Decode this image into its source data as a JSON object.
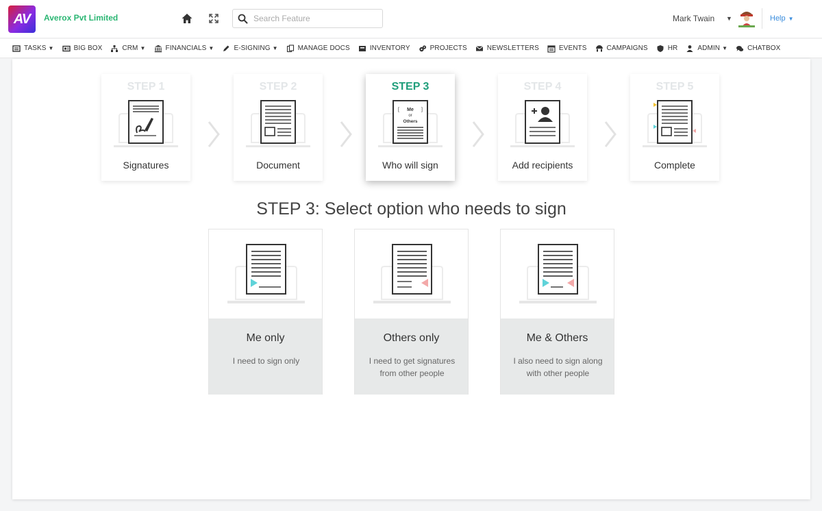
{
  "header": {
    "logo_text": "AV",
    "company": "Averox Pvt Limited",
    "search": {
      "placeholder": "Search Feature",
      "value": ""
    },
    "user_name": "Mark Twain",
    "help_label": "Help"
  },
  "menu": [
    {
      "label": "TASKS",
      "icon": "tasks-icon",
      "dropdown": true
    },
    {
      "label": "BIG BOX",
      "icon": "bigbox-icon",
      "dropdown": false
    },
    {
      "label": "CRM",
      "icon": "crm-icon",
      "dropdown": true
    },
    {
      "label": "FINANCIALS",
      "icon": "bank-icon",
      "dropdown": true
    },
    {
      "label": "E-SIGNING",
      "icon": "pen-icon",
      "dropdown": true
    },
    {
      "label": "MANAGE DOCS",
      "icon": "docs-icon",
      "dropdown": false
    },
    {
      "label": "INVENTORY",
      "icon": "inventory-icon",
      "dropdown": false
    },
    {
      "label": "PROJECTS",
      "icon": "projects-icon",
      "dropdown": false
    },
    {
      "label": "NEWSLETTERS",
      "icon": "envelope-icon",
      "dropdown": false
    },
    {
      "label": "EVENTS",
      "icon": "calendar-icon",
      "dropdown": false
    },
    {
      "label": "CAMPAIGNS",
      "icon": "campaign-icon",
      "dropdown": false
    },
    {
      "label": "HR",
      "icon": "shield-icon",
      "dropdown": false
    },
    {
      "label": "ADMIN",
      "icon": "admin-icon",
      "dropdown": true
    },
    {
      "label": "CHATBOX",
      "icon": "chat-icon",
      "dropdown": false
    }
  ],
  "steps": [
    {
      "title": "STEP 1",
      "label": "Signatures",
      "icon": "signature-document-icon",
      "active": false
    },
    {
      "title": "STEP 2",
      "label": "Document",
      "icon": "document-icon",
      "active": false
    },
    {
      "title": "STEP 3",
      "label": "Who will sign",
      "icon": "me-or-others-icon",
      "icon_text": [
        "Me",
        "or",
        "Others"
      ],
      "active": true
    },
    {
      "title": "STEP 4",
      "label": "Add recipients",
      "icon": "add-recipient-icon",
      "active": false
    },
    {
      "title": "STEP 5",
      "label": "Complete",
      "icon": "complete-document-icon",
      "active": false
    }
  ],
  "heading": "STEP 3: Select option who needs to sign",
  "options": [
    {
      "title": "Me only",
      "description": "I need to sign only",
      "icon": "me-only-document-icon"
    },
    {
      "title": "Others only",
      "description": "I need to get signatures from other people",
      "icon": "others-only-document-icon"
    },
    {
      "title": "Me & Others",
      "description": "I also need to sign along with other people",
      "icon": "me-and-others-document-icon"
    }
  ],
  "colors": {
    "accent_green": "#1f9e7b",
    "company_green": "#2bb673",
    "help_blue": "#3a8ddd",
    "marker_cyan": "#5fd3d9",
    "marker_pink": "#f3a9a9",
    "marker_yellow": "#f2c230",
    "inactive_step_title": "#e3e6e8"
  }
}
